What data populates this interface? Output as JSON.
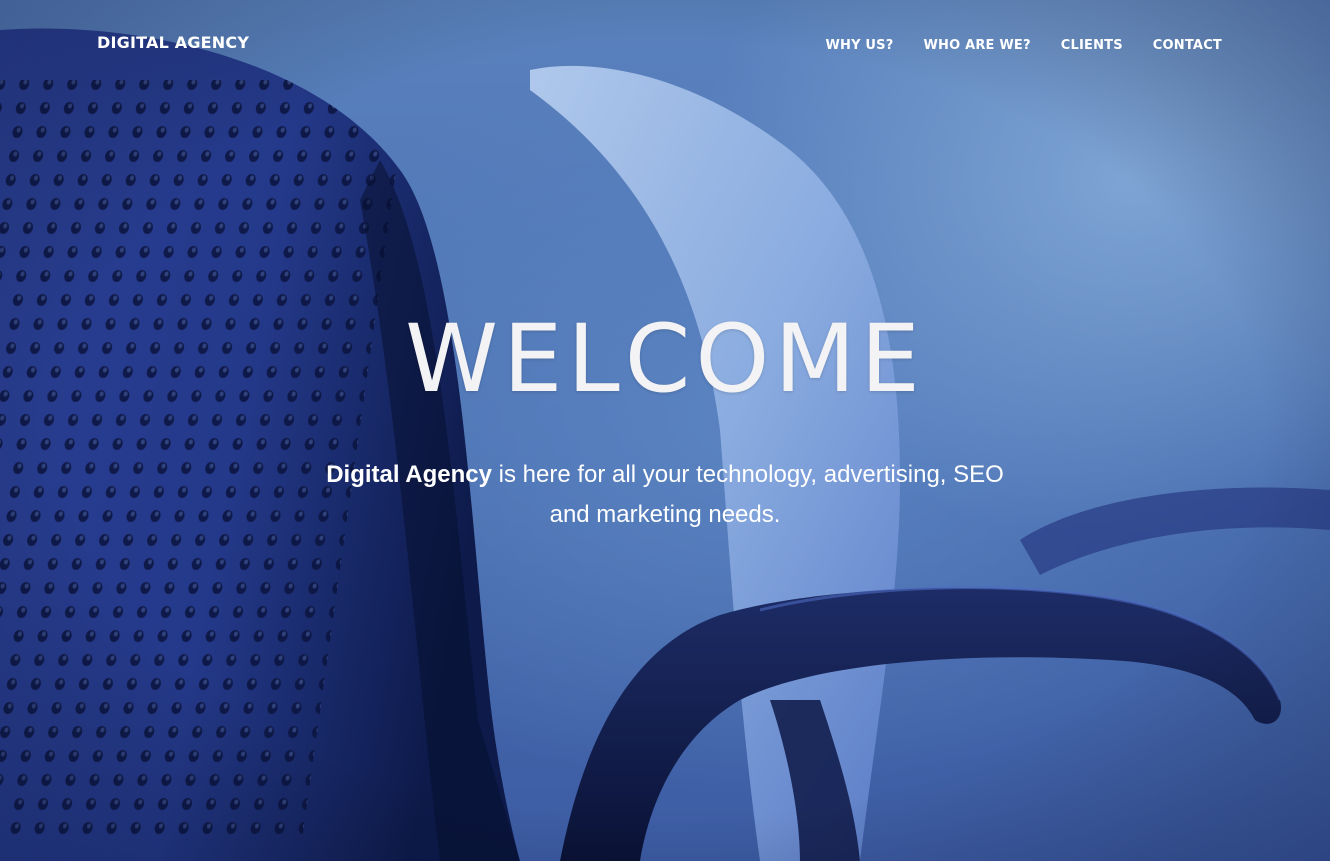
{
  "brand": {
    "name": "DIGITAL AGENCY"
  },
  "nav": {
    "items": [
      {
        "label": "WHY US?"
      },
      {
        "label": "WHO ARE WE?"
      },
      {
        "label": "CLIENTS"
      },
      {
        "label": "CONTACT"
      }
    ]
  },
  "hero": {
    "headline": "WELCOME",
    "tagline_strong": "Digital Agency",
    "tagline_rest": " is here for all your technology, advertising, SEO and marketing needs.",
    "image_icon": "office-chairs-photo"
  },
  "colors": {
    "background": "#4a6fb0",
    "text": "#ffffff"
  }
}
